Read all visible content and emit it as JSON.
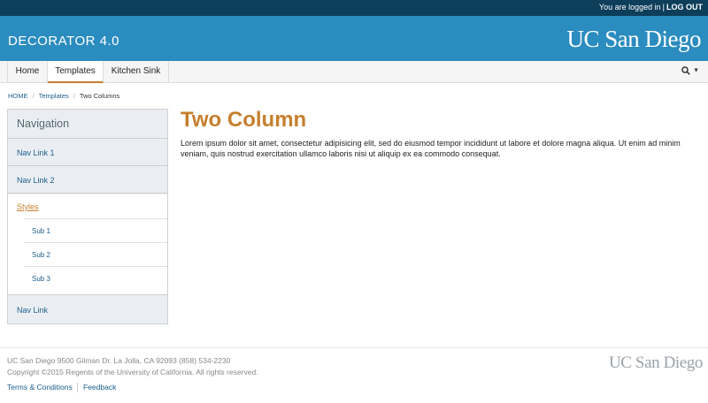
{
  "topbar": {
    "login_text": "You are logged in",
    "separator": "|",
    "logout_label": "LOG OUT"
  },
  "header": {
    "site_title": "DECORATOR 4.0",
    "logo_text": "UC San Diego",
    "header_color": "#2b8cbf",
    "topbar_color": "#0d3e5a"
  },
  "navbar": {
    "tabs": [
      {
        "label": "Home"
      },
      {
        "label": "Templates"
      },
      {
        "label": "Kitchen Sink"
      }
    ],
    "search_icon": "search-icon",
    "caret_icon": "caret-down-icon"
  },
  "breadcrumb": {
    "items": [
      "HOME",
      "Templates",
      "Two Columns"
    ],
    "separator": "/"
  },
  "sidebar": {
    "heading": "Navigation",
    "items": [
      {
        "label": "Nav Link 1"
      },
      {
        "label": "Nav Link 2"
      }
    ],
    "active_group": {
      "label": "Styles",
      "subitems": [
        "Sub 1",
        "Sub 2",
        "Sub 3"
      ]
    },
    "last_item": "Nav Link"
  },
  "main": {
    "title": "Two Column",
    "body": "Lorem ipsum dolor sit amet, consectetur adipisicing elit, sed do eiusmod tempor incididunt ut labore et dolore magna aliqua. Ut enim ad minim veniam, quis nostrud exercitation ullamco laboris nisi ut aliquip ex ea commodo consequat.",
    "accent_color": "#c57f2e"
  },
  "footer": {
    "address": "UC San Diego 9500 Gilman Dr. La Jolla, CA 92093 (858) 534-2230",
    "copyright": "Copyright ©2015 Regents of the University of California. All rights reserved.",
    "links": [
      "Terms & Conditions",
      "Feedback"
    ],
    "logo_text": "UC San Diego"
  }
}
